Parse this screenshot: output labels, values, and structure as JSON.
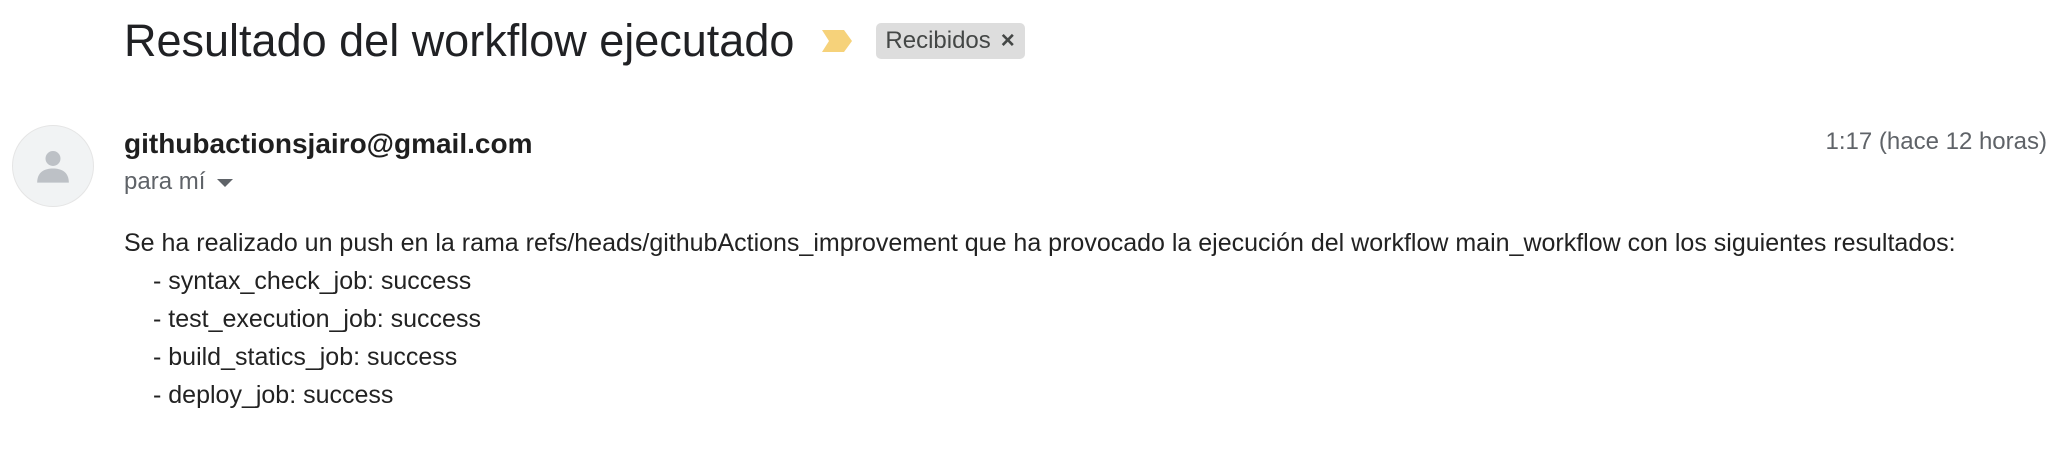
{
  "email": {
    "subject": "Resultado del workflow ejecutado",
    "label": "Recibidos",
    "label_close_symbol": "×",
    "importance_icon": "importance-marker-icon",
    "importance_color": "#f6d27a",
    "sender": "githubactionsjairo@gmail.com",
    "recipient": "para mí",
    "timestamp": "1:17 (hace 12 horas)",
    "avatar_icon": "default-person-icon",
    "body": {
      "intro": "Se ha realizado un push en la rama refs/heads/githubActions_improvement que ha provocado la ejecución del workflow main_workflow con los siguientes resultados:",
      "jobs": [
        "- syntax_check_job: success",
        "- test_execution_job: success",
        "- build_statics_job: success",
        "- deploy_job: success"
      ]
    }
  }
}
